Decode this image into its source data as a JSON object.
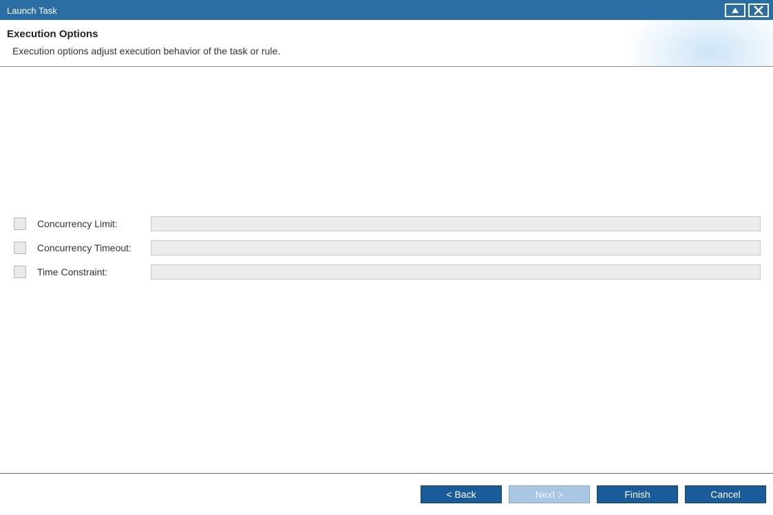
{
  "window": {
    "title": "Launch Task"
  },
  "header": {
    "title": "Execution Options",
    "description": "Execution options adjust execution behavior of the task or rule."
  },
  "options": {
    "concurrency_limit": {
      "label": "Concurrency Limit:",
      "value": ""
    },
    "concurrency_timeout": {
      "label": "Concurrency Timeout:",
      "value": ""
    },
    "time_constraint": {
      "label": "Time Constraint:",
      "value": ""
    }
  },
  "footer": {
    "back": "< Back",
    "next": "Next >",
    "finish": "Finish",
    "cancel": "Cancel"
  }
}
